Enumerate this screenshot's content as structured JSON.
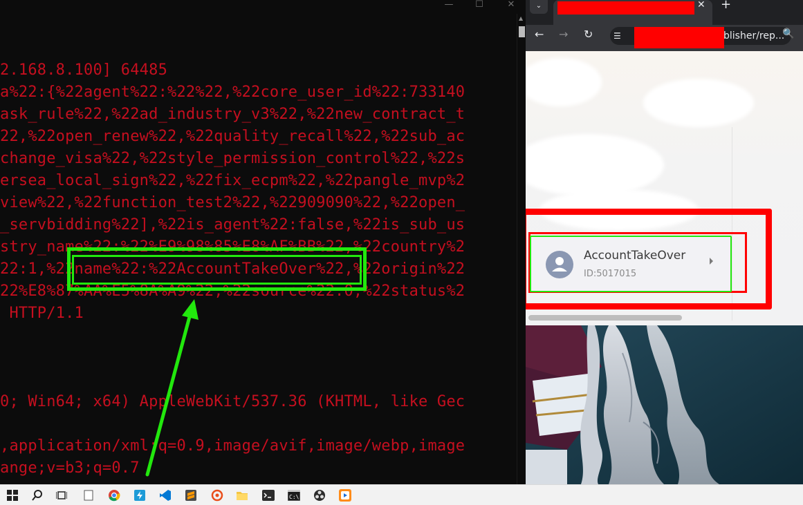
{
  "terminal": {
    "window_controls": {
      "minimize": "—",
      "maximize": "☐",
      "close": "✕"
    },
    "lines": [
      "2.168.8.100] 64485",
      "a%22:{%22agent%22:%22%22,%22core_user_id%22:733140",
      "ask_rule%22,%22ad_industry_v3%22,%22new_contract_t",
      "22,%22open_renew%22,%22quality_recall%22,%22sub_ac",
      "change_visa%22,%22style_permission_control%22,%22s",
      "ersea_local_sign%22,%22fix_ecpm%22,%22pangle_mvp%2",
      "view%22,%22function_test2%22,%22909090%22,%22open_",
      "_servbidding%22],%22is_agent%22:false,%22is_sub_us",
      "stry_name%22:%22%E9%98%85%E8%AF%BB%22,%22country%2",
      "22:1,%22name%22:%22AccountTakeOver%22,%22origin%22",
      "22%E8%87%AA%E5%8A%A9%22,%22source%22:0,%22status%2",
      " HTTP/1.1",
      "",
      "",
      "",
      "0; Win64; x64) AppleWebKit/537.36 (KHTML, like Gec",
      "",
      ",application/xml;q=0.9,image/avif,image/webp,image",
      "ange;v=b3;q=0.7"
    ],
    "text_color": "#c50f1f",
    "highlight_color": "#22e80d"
  },
  "browser": {
    "tab": {
      "close_label": "✕"
    },
    "new_tab_label": "+",
    "tab_menu_label": "⌄",
    "nav": {
      "back": "←",
      "forward": "→",
      "reload": "↻"
    },
    "url_visible": "blisher/rep...",
    "zoom_icon": "🔍",
    "account": {
      "name": "AccountTakeOver",
      "id": "ID:5017015"
    },
    "redaction_color": "#ff0000"
  },
  "taskbar": {
    "icons": [
      "windows-start-icon",
      "search-icon",
      "task-view-icon",
      "notepad-icon",
      "chrome-icon",
      "app-blue-icon",
      "vscode-icon",
      "sublime-icon",
      "burp-icon",
      "file-explorer-icon",
      "terminal-icon",
      "cmd-icon",
      "obs-icon",
      "media-player-icon"
    ]
  }
}
